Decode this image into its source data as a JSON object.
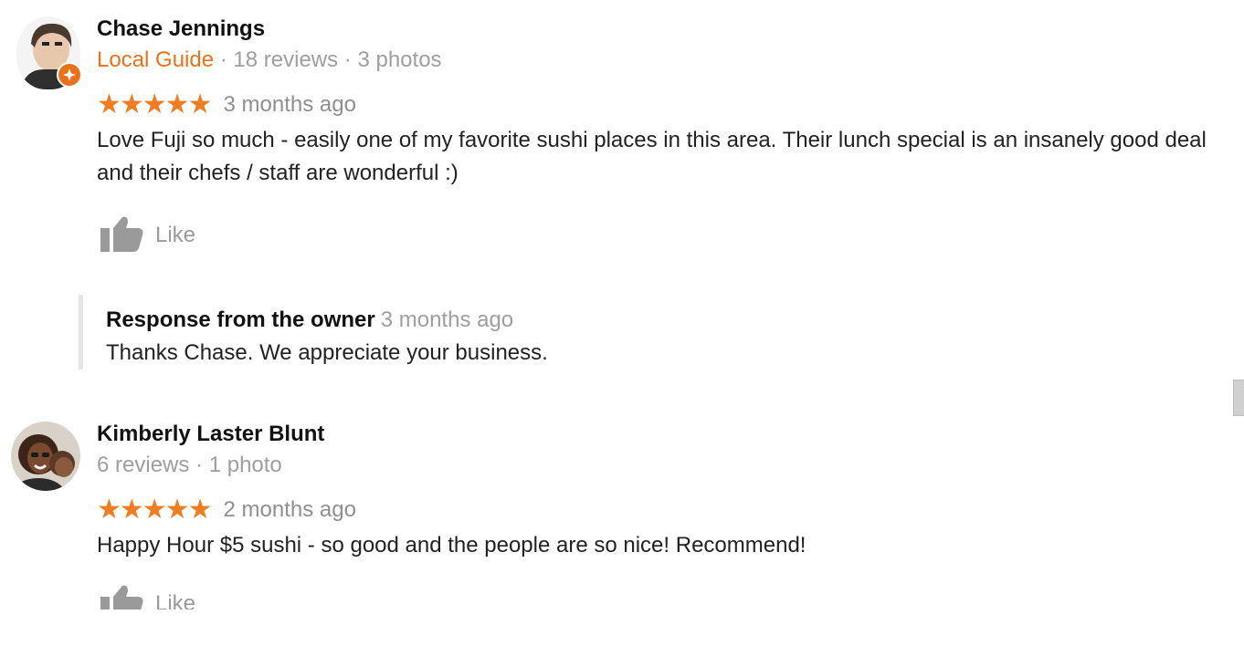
{
  "reviews": [
    {
      "author": "Chase Jennings",
      "local_guide_label": "Local Guide",
      "separator": " · ",
      "reviews_count": "18 reviews",
      "photos_count": "3 photos",
      "stars": "★★★★★",
      "rating": 5,
      "time_ago": "3 months ago",
      "text": "Love Fuji so much - easily one of my favorite sushi places in this area. Their lunch special is an insanely good deal and their chefs / staff are wonderful :)",
      "like_label": "Like",
      "owner_response": {
        "title": "Response from the owner",
        "time_ago": "3 months ago",
        "text": "Thanks Chase. We appreciate your business."
      }
    },
    {
      "author": "Kimberly Laster Blunt",
      "separator": " · ",
      "reviews_count": "6 reviews",
      "photos_count": "1 photo",
      "stars": "★★★★★",
      "rating": 5,
      "time_ago": "2 months ago",
      "text": "Happy Hour $5 sushi - so good and the people are so nice! Recommend!",
      "like_label": "Like"
    }
  ],
  "colors": {
    "accent_orange": "#e8711a",
    "star_orange": "#f07d21",
    "muted_gray": "#9e9e9e"
  },
  "icons": {
    "like": "thumbs-up-icon",
    "local_guide": "local-guide-badge-icon"
  }
}
